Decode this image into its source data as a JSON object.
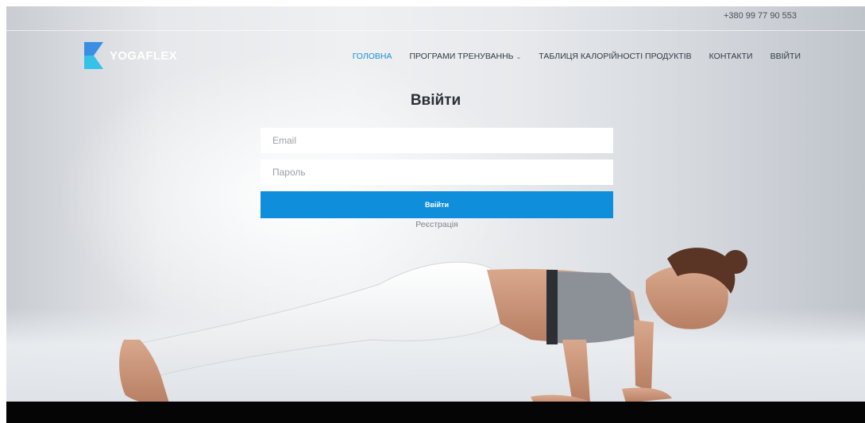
{
  "topbar": {
    "phone": "+380 99 77 90 553"
  },
  "brand": {
    "name": "YOGAFLEX",
    "logo_color_top": "#3a8ee6",
    "logo_color_bottom": "#36c2e8"
  },
  "nav": {
    "items": [
      {
        "label": "ГОЛОВНА",
        "active": true
      },
      {
        "label": "ПРОГРАМИ ТРЕНУВАННЬ",
        "has_dropdown": true
      },
      {
        "label": "ТАБЛИЦЯ КАЛОРІЙНОСТІ ПРОДУКТІВ"
      },
      {
        "label": "КОНТАКТИ"
      },
      {
        "label": "ВВІЙТИ"
      }
    ],
    "accent_color": "#1a8fd6"
  },
  "form": {
    "title": "Ввійти",
    "email_placeholder": "Email",
    "password_placeholder": "Пароль",
    "submit_label": "Ввійти",
    "register_label": "Реєстрація",
    "button_color": "#0f8fdb"
  }
}
